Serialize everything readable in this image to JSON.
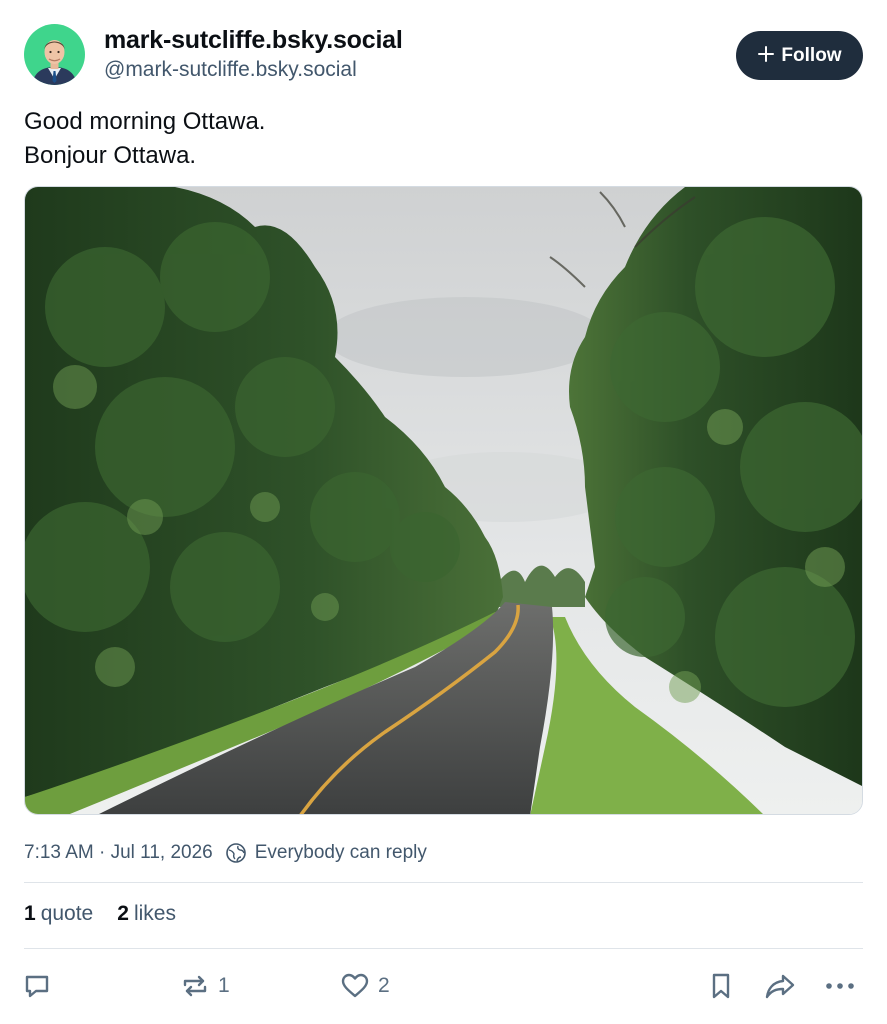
{
  "author": {
    "display_name": "mark-sutcliffe.bsky.social",
    "handle": "@mark-sutcliffe.bsky.social"
  },
  "follow_button": {
    "icon": "plus-icon",
    "label": "Follow"
  },
  "post": {
    "lines": [
      "Good morning Ottawa.",
      "Bonjour Ottawa."
    ]
  },
  "meta": {
    "timestamp": "7:13 AM · Jul 11, 2026",
    "reply_icon": "globe-icon",
    "reply_setting": "Everybody can reply"
  },
  "stats": {
    "quotes_count": "1",
    "quotes_label": "quote",
    "likes_count": "2",
    "likes_label": "likes"
  },
  "actions": {
    "reply_icon": "comment-icon",
    "repost_icon": "repost-icon",
    "repost_count": "1",
    "like_icon": "heart-icon",
    "like_count": "2",
    "bookmark_icon": "bookmark-icon",
    "share_icon": "share-icon",
    "more_icon": "more-icon"
  },
  "colors": {
    "follow_bg": "#1f2d3d",
    "secondary_text": "#42576c",
    "action_icon": "#5b6f82"
  }
}
